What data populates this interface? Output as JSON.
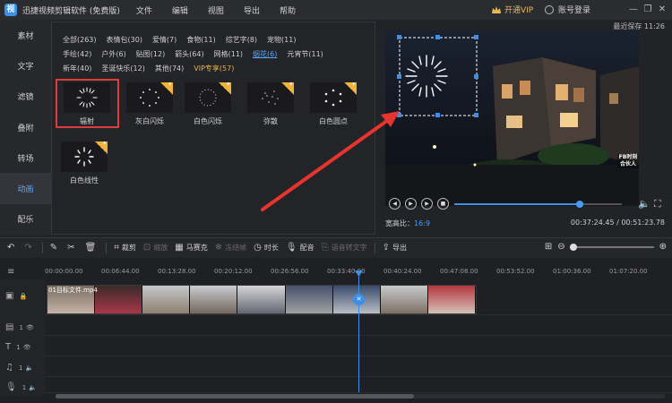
{
  "titlebar": {
    "app_logo": "视",
    "app_title": "迅捷视频剪辑软件 (免费版)",
    "menu": [
      "文件",
      "编辑",
      "视图",
      "导出",
      "帮助"
    ],
    "vip_label": "开通VIP",
    "login_label": "账号登录",
    "window_controls": [
      "—",
      "❐",
      "✕"
    ]
  },
  "sidebar": {
    "items": [
      {
        "label": "素材"
      },
      {
        "label": "文字"
      },
      {
        "label": "滤镜"
      },
      {
        "label": "叠附"
      },
      {
        "label": "转场"
      },
      {
        "label": "动画"
      },
      {
        "label": "配乐"
      }
    ],
    "active_index": 5
  },
  "effects": {
    "categories_rows": [
      [
        {
          "label": "全部(263)"
        },
        {
          "label": "表情包(30)"
        },
        {
          "label": "爱情(7)"
        },
        {
          "label": "食物(11)"
        },
        {
          "label": "综艺字(8)"
        },
        {
          "label": "宠物(11)"
        }
      ],
      [
        {
          "label": "手绘(42)"
        },
        {
          "label": "户外(6)"
        },
        {
          "label": "贴图(12)"
        },
        {
          "label": "箭头(64)"
        },
        {
          "label": "网格(11)"
        },
        {
          "label": "烟花(6)",
          "active": true
        },
        {
          "label": "元宵节(11)"
        }
      ],
      [
        {
          "label": "新年(40)"
        },
        {
          "label": "圣诞快乐(12)"
        },
        {
          "label": "其他(74)"
        },
        {
          "label": "VIP专享(57)",
          "vip": true
        }
      ]
    ],
    "thumbnails": [
      {
        "label": "辐射",
        "selected": true,
        "download": false
      },
      {
        "label": "灰白闪烁",
        "download": true
      },
      {
        "label": "白色闪烁",
        "download": true
      },
      {
        "label": "弥散",
        "download": true
      },
      {
        "label": "白色圆点",
        "download": true
      },
      {
        "label": "白色线性",
        "download": true
      }
    ]
  },
  "preview": {
    "save_time_label": "最近保存 11:26",
    "watermark": "FB时刻 合伙人",
    "ratio_label": "宽高比：",
    "ratio_value": "16:9",
    "time_readout": "00:37:24.45 / 00:51:23.78",
    "progress": 0.75
  },
  "toolbar": {
    "crop": "裁剪",
    "zoom": "缩放",
    "mosaic": "马赛克",
    "freeze": "冻结帧",
    "duration": "时长",
    "voiceover": "配音",
    "speech_to_text": "语音转文字",
    "export": "导出",
    "zoom_level": 0.0
  },
  "timeline": {
    "ruler": [
      "00:00:00.00",
      "00:06:44.00",
      "00:13:28.00",
      "00:20:12.00",
      "00:26:56.00",
      "00:33:40.00",
      "00:40:24.00",
      "00:47:08.00",
      "00:53:52.00",
      "01:00:36.00",
      "01:07:20.00"
    ],
    "clip_label": "01目标文件.mp4",
    "track_counts": [
      "1",
      "1",
      "1",
      "1"
    ]
  },
  "colors": {
    "accent": "#3d8fe8",
    "vip_gold": "#e8b95a",
    "highlight_red": "#e03b3b"
  }
}
